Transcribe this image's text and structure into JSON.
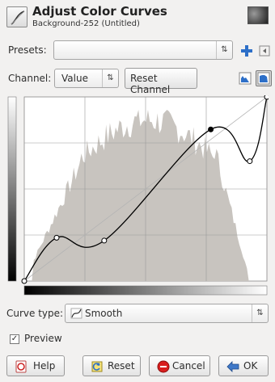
{
  "header": {
    "title": "Adjust Color Curves",
    "subtitle": "Background-252 (Untitled)"
  },
  "presets": {
    "label": "Presets:",
    "value": "",
    "arrow": "⇅"
  },
  "channel": {
    "label": "Channel:",
    "value": "Value",
    "arrow": "⇅",
    "reset_label": "Reset Channel"
  },
  "curve": {
    "input_range": [
      0,
      255
    ],
    "output_range": [
      0,
      255
    ],
    "control_points": [
      [
        0,
        0
      ],
      [
        34,
        60
      ],
      [
        84,
        56
      ],
      [
        196,
        210
      ],
      [
        237,
        166
      ],
      [
        255,
        255
      ]
    ],
    "selected_point_index": 3,
    "histogram_color": "#c8c4bf",
    "curve_color": "#000000",
    "grid_lines": 4
  },
  "curve_type": {
    "label": "Curve type:",
    "value": "Smooth",
    "arrow": "⇅"
  },
  "preview": {
    "label": "Preview",
    "checked_glyph": "✓"
  },
  "buttons": {
    "help": "Help",
    "reset": "Reset",
    "cancel": "Cancel",
    "ok": "OK"
  },
  "colors": {
    "cancel_red": "#d81e1e",
    "ok_blue": "#3f78c8",
    "add_blue": "#2d6fc8"
  }
}
